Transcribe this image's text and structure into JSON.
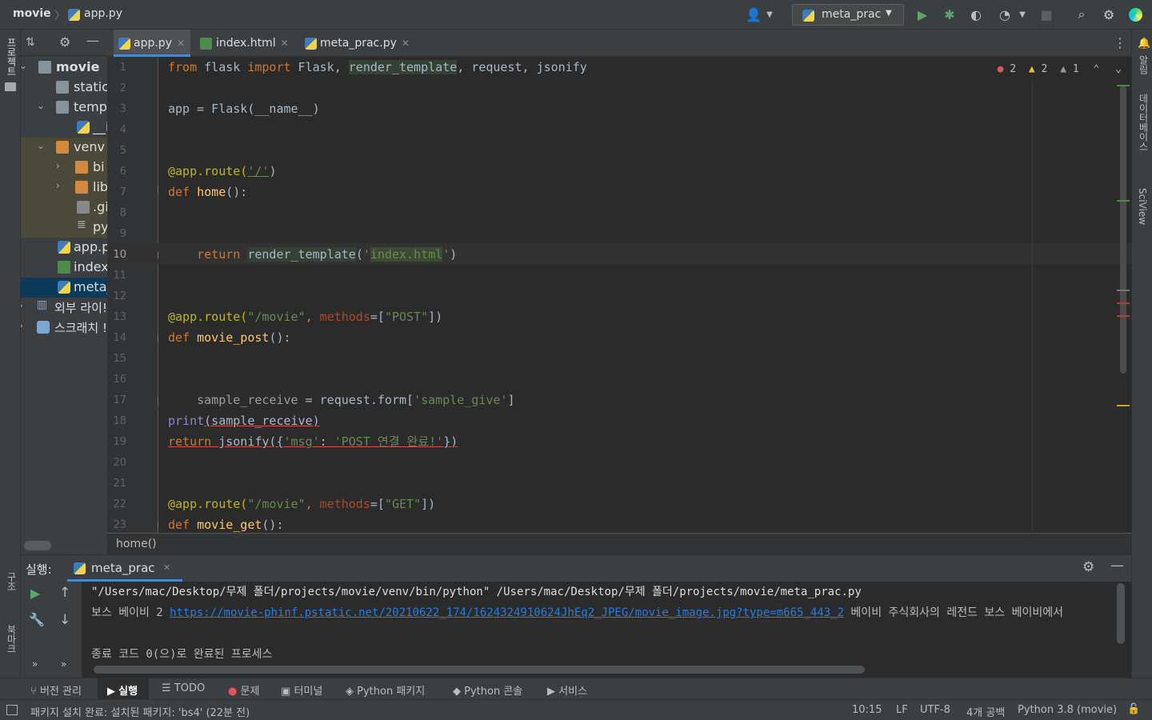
{
  "titlebar": {
    "project": "movie",
    "file": "app.py",
    "run_config": "meta_prac"
  },
  "left_strip": {
    "project_label": "프로젝트",
    "structure_label": "구조",
    "bookmarks_label": "북마크"
  },
  "right_strip": {
    "notifications_label": "알림",
    "database_label": "데이터베이스",
    "sciview_label": "SciView"
  },
  "project_tree": [
    {
      "label": "movie",
      "type": "root",
      "expanded": true
    },
    {
      "label": "static",
      "type": "folder"
    },
    {
      "label": "temp",
      "type": "folder",
      "expanded": true
    },
    {
      "label": "__i",
      "type": "py"
    },
    {
      "label": "venv",
      "type": "folder-orange",
      "expanded": true
    },
    {
      "label": "bi",
      "type": "folder-orange"
    },
    {
      "label": "lib",
      "type": "folder-orange"
    },
    {
      "label": ".gi",
      "type": "file"
    },
    {
      "label": "py",
      "type": "file"
    },
    {
      "label": "app.p",
      "type": "py"
    },
    {
      "label": "index",
      "type": "html"
    },
    {
      "label": "meta_",
      "type": "py"
    },
    {
      "label": "외부 라이!",
      "type": "library"
    },
    {
      "label": "스크래치 !",
      "type": "scratch"
    }
  ],
  "tabs": [
    {
      "label": "app.py",
      "active": true
    },
    {
      "label": "index.html",
      "active": false
    },
    {
      "label": "meta_prac.py",
      "active": false
    }
  ],
  "inspections": {
    "errors": "2",
    "warnings": "2",
    "weak_warnings": "1"
  },
  "line_numbers": [
    "1",
    "2",
    "3",
    "4",
    "5",
    "6",
    "7",
    "8",
    "9",
    "10",
    "11",
    "12",
    "13",
    "14",
    "15",
    "16",
    "17",
    "18",
    "19",
    "20",
    "21",
    "22",
    "23"
  ],
  "code": {
    "l1": {
      "a": "from",
      "b": " flask ",
      "c": "import",
      "d": " Flask, ",
      "e": "render_template",
      "f": ", request, jsonify"
    },
    "l3": {
      "a": "app = Flask(__name__)"
    },
    "l6": {
      "a": "@app.route(",
      "b": "'/'",
      "c": ")"
    },
    "l7": {
      "a": "def",
      "b": " ",
      "c": "home",
      "d": "():"
    },
    "l10": {
      "a": "    return",
      "b": " ",
      "c": "render_template",
      "d": "(",
      "e": "'",
      "f": "index.html",
      "g": "'",
      "h": ")"
    },
    "l13": {
      "a": "@app.route(",
      "b": "\"/movie\"",
      "c": ", ",
      "d": "methods",
      "e": "=[",
      "f": "\"POST\"",
      "g": "])"
    },
    "l14": {
      "a": "def",
      "b": " ",
      "c": "movie_post",
      "d": "():"
    },
    "l17": {
      "a": "    sample_receive",
      "b": " = request.form[",
      "c": "'sample_give'",
      "d": "]"
    },
    "l18": {
      "a": "print",
      "b": "(sample_receive)"
    },
    "l19": {
      "a": "return",
      "b": " jsonify({",
      "c": "'msg'",
      "d": ": ",
      "e": "'POST 연결 완료!'",
      "f": "})"
    },
    "l22": {
      "a": "@app.route(",
      "b": "\"/movie\"",
      "c": ", ",
      "d": "methods",
      "e": "=[",
      "f": "\"GET\"",
      "g": "])"
    },
    "l23": {
      "a": "def",
      "b": " ",
      "c": "movie_get",
      "d": "():"
    }
  },
  "breadcrumb": "home()",
  "run_panel": {
    "label": "실행:",
    "tab": "meta_prac",
    "console": {
      "line1": "\"/Users/mac/Desktop/무제 폴더/projects/movie/venv/bin/python\" /Users/mac/Desktop/무제 폴더/projects/movie/meta_prac.py",
      "line2_prefix": "보스 베이비 2 ",
      "line2_link": "https://movie-phinf.pstatic.net/20210622_174/1624324910624JhEq2_JPEG/movie_image.jpg?type=m665_443_2",
      "line2_suffix": " 베이비 주식회사의 레전드 보스 베이비에서",
      "line4": "종료 코드 0(으)로 완료된 프로세스"
    }
  },
  "bottom_tools": [
    {
      "label": "버전 관리",
      "icon": "branch-icon"
    },
    {
      "label": "실행",
      "icon": "play-icon",
      "active": true
    },
    {
      "label": "TODO",
      "icon": "list-icon"
    },
    {
      "label": "문제",
      "icon": "error-icon"
    },
    {
      "label": "터미널",
      "icon": "terminal-icon"
    },
    {
      "label": "Python 패키지",
      "icon": "layers-icon"
    },
    {
      "label": "Python 콘솔",
      "icon": "python-icon"
    },
    {
      "label": "서비스",
      "icon": "services-icon"
    }
  ],
  "status": {
    "message": "패키지 설치 완료: 설치된 패키지: 'bs4' (22분 전)",
    "position": "10:15",
    "line_sep": "LF",
    "encoding": "UTF-8",
    "indent": "4개 공백",
    "interpreter": "Python 3.8 (movie)"
  },
  "colors": {
    "accent": "#4a88c7",
    "keyword": "#cc7832",
    "function": "#ffc66d",
    "string": "#6a8759",
    "error": "#d25252",
    "run_green": "#59a869"
  }
}
